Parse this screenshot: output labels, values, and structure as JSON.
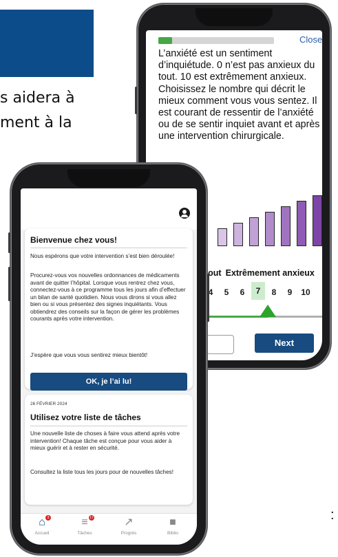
{
  "background": {
    "line1": "s aidera à",
    "line2": "ment à la",
    "colon": ":"
  },
  "anxiety_screen": {
    "progress_fraction": 0.12,
    "close_label": "Close",
    "text": "L’anxiété est un sentiment d’inquiétude. 0 n’est pas anxieux du tout. 10 est extrêmement anxieux. Choisissez le nombre qui décrit le mieux comment vous vous sentez. Il est courant de ressentir de l’anxiété ou de se sentir inquiet avant et après une intervention chirurgicale.",
    "scale_label_low": "tout",
    "scale_label_high": "Extrêmement anxieux",
    "numbers": [
      "4",
      "5",
      "6",
      "7",
      "8",
      "9",
      "10"
    ],
    "selected_value": "7",
    "next_label": "Next",
    "bar_colors": [
      "#d9c6e6",
      "#cdb4de",
      "#c1a2d6",
      "#b18ccb",
      "#a073c0",
      "#8f5bb4",
      "#7d45a8",
      "#6d33a0"
    ]
  },
  "home_screen": {
    "welcome": {
      "title": "Bienvenue chez vous!",
      "p1": "Nous espérons que votre intervention s’est bien déroulée!",
      "p2": "Procurez-vous vos nouvelles ordonnances de médicaments avant de quitter l’hôpital. Lorsque vous rentrez chez vous, connectez-vous à ce programme tous les jours afin d’effectuer un bilan de santé quotidien. Nous vous dirons si vous allez bien ou si vous présentez des signes inquiétants. Vous obtiendrez des conseils sur la façon de gérer les problèmes courants après votre intervention.",
      "p3": "J’espère que vous vous sentirez mieux bientôt!",
      "button": "OK, je l’ai lu!"
    },
    "tasks": {
      "date": "26 FÉVRIER 2024",
      "title": "Utilisez votre liste de tâches",
      "p1": "Une nouvelle liste de choses à faire vous attend après votre intervention! Chaque tâche est conçue pour vous aider à mieux guérir et à rester en sécurité.",
      "p2": "Consultez la liste tous les jours pour de nouvelles tâches!"
    },
    "tabs": [
      {
        "label": "Accueil",
        "icon": "home-icon",
        "badge": "3",
        "active": true
      },
      {
        "label": "Tâches",
        "icon": "list-icon",
        "badge": "17",
        "active": false
      },
      {
        "label": "Progrès",
        "icon": "trend-icon",
        "badge": "",
        "active": false
      },
      {
        "label": "Biblio",
        "icon": "book-icon",
        "badge": "",
        "active": false
      }
    ],
    "accent_color": "#184b80",
    "badge_color": "#d62828"
  }
}
